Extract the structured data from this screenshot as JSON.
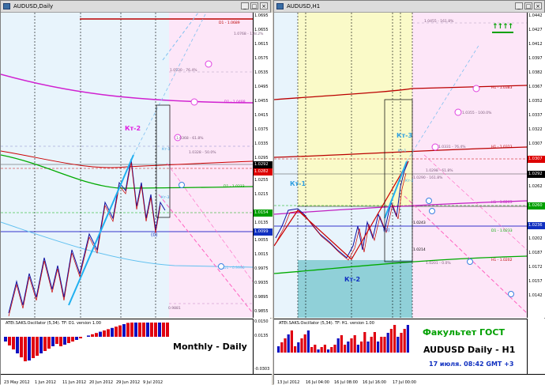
{
  "left": {
    "title": "AUDUSD,Daily",
    "buttons": [
      "_",
      "□",
      "×"
    ],
    "price_labels": [
      "1.0695",
      "1.0655",
      "1.0615",
      "1.0575",
      "1.0535",
      "1.0495",
      "1.0455",
      "1.0415",
      "1.0375",
      "1.0335",
      "1.0295",
      "1.0255",
      "1.0215",
      "1.0175",
      "1.0135",
      "1.0095",
      "1.0055",
      "1.0015",
      "0.9975",
      "0.9935",
      "0.9895",
      "0.9855"
    ],
    "price_boxes": [
      {
        "text": "1.0292",
        "color": "#ffffff",
        "bg": "#000000"
      },
      {
        "text": "1.0282",
        "color": "#ffffff",
        "bg": "#dd0000"
      },
      {
        "text": "1.0154",
        "color": "#ffffff",
        "bg": "#00a000"
      },
      {
        "text": "1.0099",
        "color": "#ffffff",
        "bg": "#1030c0"
      }
    ],
    "level_labels": [
      "D1 - 1.0689",
      "1.0768 - 138.2%",
      "1.0530 - 76.4%",
      "D1 - 1.0488",
      "1.0368 - 61.8%",
      "1.0328 - 50.0%",
      "D1 - 1.0233",
      "0.9881",
      "D1 - 0.9996"
    ],
    "kt_labels": [
      "Кт-2",
      "Кт-1",
      "Кт-3",
      "(0)"
    ],
    "osc_title": "ATEt.SAKS.Oscillator (5,34). TF: D1. version 1.00",
    "osc_scale": [
      "0.0150",
      "0.0135",
      "-0.0303"
    ],
    "osc_caption": "Monthly - Daily",
    "time_labels": [
      "23 May 2012",
      "1 Jun 2012",
      "11 Jun 2012",
      "20 Jun 2012",
      "29 Jun 2012",
      "9 Jul 2012"
    ]
  },
  "right": {
    "title": "AUDUSD,H1",
    "buttons": [
      "_",
      "□",
      "×"
    ],
    "price_labels": [
      "1.0442",
      "1.0427",
      "1.0412",
      "1.0397",
      "1.0382",
      "1.0367",
      "1.0352",
      "1.0337",
      "1.0322",
      "1.0307",
      "1.0292",
      "1.0277",
      "1.0262",
      "1.0247",
      "1.0232",
      "1.0217",
      "1.0202",
      "1.0187",
      "1.0172",
      "1.0157",
      "1.0142"
    ],
    "price_boxes": [
      {
        "text": "1.0307",
        "color": "#ffffff",
        "bg": "#dd0000"
      },
      {
        "text": "1.0292",
        "color": "#ffffff",
        "bg": "#000000"
      },
      {
        "text": "1.0260",
        "color": "#ffffff",
        "bg": "#00a000"
      },
      {
        "text": "1.0236",
        "color": "#ffffff",
        "bg": "#1030c0"
      }
    ],
    "level_labels": [
      "1.0455 - 161.8%",
      "H1 - 1.0383",
      "1.0355 - 100.0%",
      "H1 - 1.0323",
      "1.0331 - 76.4%",
      "1.0298 - 61.8%",
      "1.0290 - 161.8%",
      "H1 - 1.0263",
      "1.0243",
      "D1 - 1.0233",
      "1.0214",
      "H1 - 1.0202",
      "1.0201 - 0.0%"
    ],
    "kt_labels": [
      "Кт-3",
      "Кт-1",
      "Кт-2",
      "(0)",
      "Кт-1",
      "Кт-2"
    ],
    "osc_title": "ATEt.SAKS.Oscillator (5,34). TF: H1. version 1.00",
    "caption_1": "Факультет ГОСТ",
    "caption_2": "AUDUSD Daily - H1",
    "caption_3": "17 июля. 08:42 GMT +3",
    "time_labels": [
      "13 Jul 2012",
      "16 Jul 04:00",
      "16 Jul 08:00",
      "16 Jul 16:00",
      "17 Jul 00:00"
    ]
  }
}
